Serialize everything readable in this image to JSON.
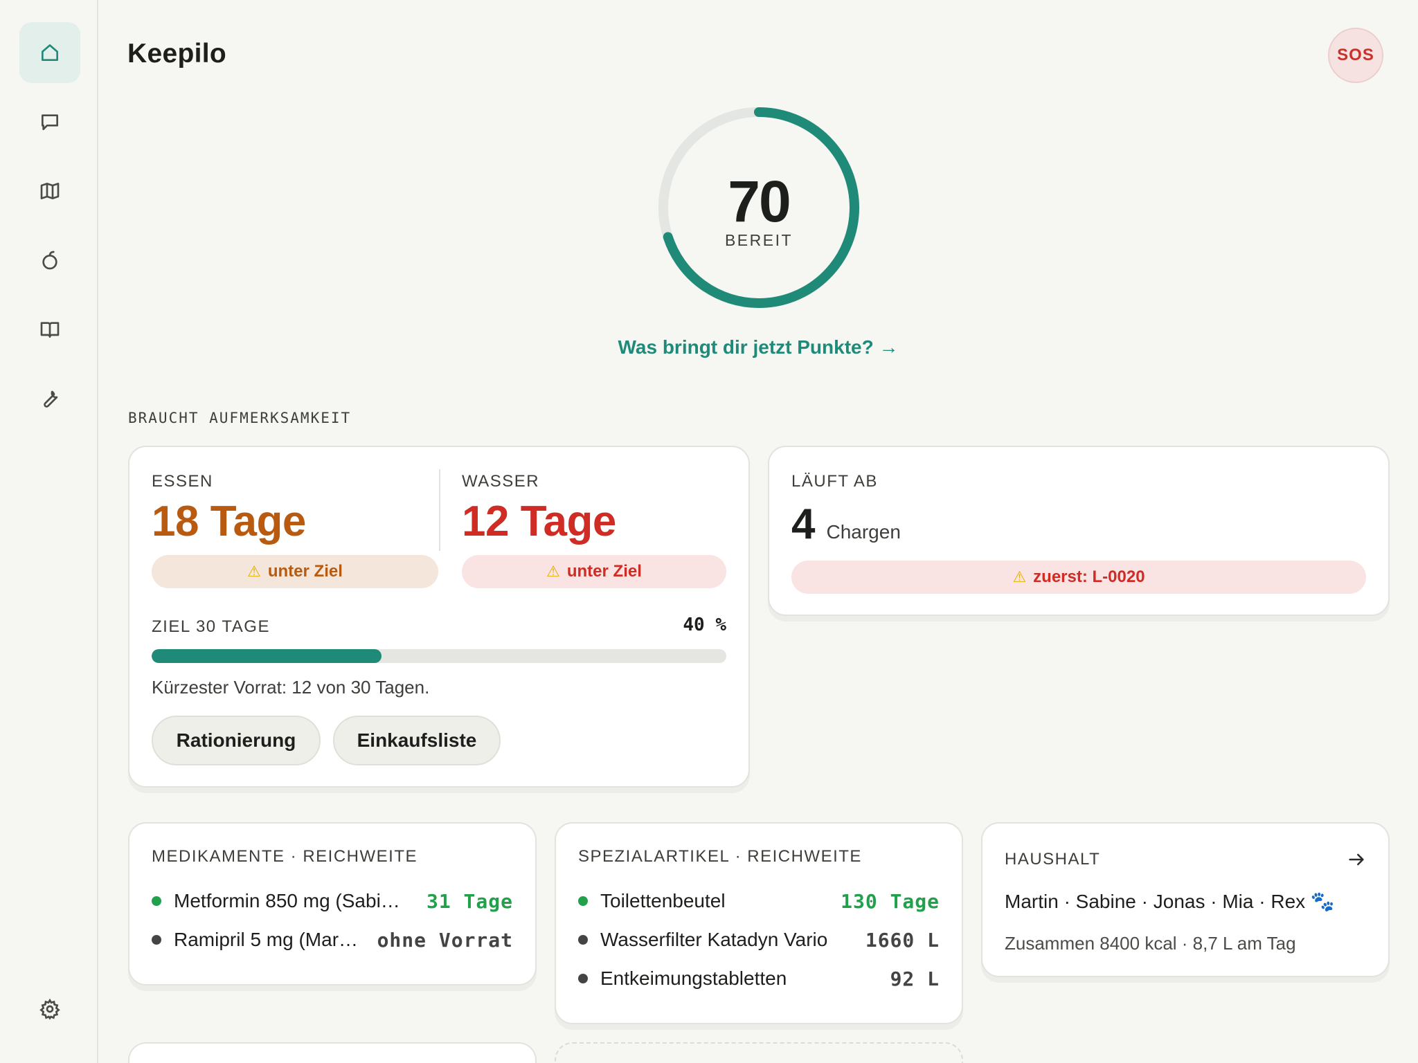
{
  "app": {
    "title": "Keepilo",
    "sos_label": "SOS"
  },
  "sidebar": {
    "items": [
      {
        "name": "home",
        "icon": "home-icon",
        "active": true
      },
      {
        "name": "chat",
        "icon": "chat-icon",
        "active": false
      },
      {
        "name": "map",
        "icon": "map-icon",
        "active": false
      },
      {
        "name": "food",
        "icon": "apple-icon",
        "active": false
      },
      {
        "name": "guide",
        "icon": "book-icon",
        "active": false
      },
      {
        "name": "tools",
        "icon": "wrench-icon",
        "active": false
      }
    ],
    "settings_icon": "gear-icon"
  },
  "score": {
    "value": "70",
    "label": "BEREIT",
    "fraction": 0.7,
    "color": "#1f8a78",
    "track_color": "#e3e6e2"
  },
  "points_link": "Was bringt dir jetzt Punkte? →",
  "section_title": "BRAUCHT AUFMERKSAMKEIT",
  "supply_card": {
    "food": {
      "caption": "ESSEN",
      "days": "18 Tage",
      "pill": "unter Ziel",
      "color": "#b85a10",
      "pill_bg": "#f4e6da"
    },
    "water": {
      "caption": "WASSER",
      "days": "12 Tage",
      "pill": "unter Ziel",
      "color": "#cf2c25",
      "pill_bg": "#f9e4e3"
    },
    "goal_label": "ZIEL 30 TAGE",
    "goal_percent": "40 %",
    "goal_fraction": 0.4,
    "note": "Kürzester Vorrat: 12 von 30 Tagen.",
    "buttons": [
      "Rationierung",
      "Einkaufsliste"
    ]
  },
  "expiry_card": {
    "caption": "LÄUFT AB",
    "count": "4",
    "unit": "Chargen",
    "pill": "zuerst: L-0020",
    "color": "#cf2c25",
    "pill_bg": "#f9e4e3"
  },
  "meds_card": {
    "caption": "MEDIKAMENTE · REICHWEITE",
    "items": [
      {
        "name": "Metformin 850 mg (Sabi…",
        "value": "31 Tage",
        "status": "ok"
      },
      {
        "name": "Ramipril 5 mg (Mar…",
        "value": "ohne Vorrat",
        "status": "none"
      }
    ]
  },
  "special_card": {
    "caption": "SPEZIALARTIKEL · REICHWEITE",
    "items": [
      {
        "name": "Toilettenbeutel",
        "value": "130 Tage",
        "status": "ok"
      },
      {
        "name": "Wasserfilter Katadyn Vario",
        "value": "1660 L",
        "status": "none"
      },
      {
        "name": "Entkeimungstabletten",
        "value": "92 L",
        "status": "none"
      }
    ]
  },
  "household_card": {
    "caption": "HAUSHALT",
    "members": "Martin · Sabine · Jonas · Mia · Rex 🐾",
    "summary": "Zusammen 8400 kcal · 8,7 L am Tag"
  },
  "colors": {
    "ok": "#22a04b",
    "neutral": "#444444",
    "accent": "#1f8a78"
  }
}
